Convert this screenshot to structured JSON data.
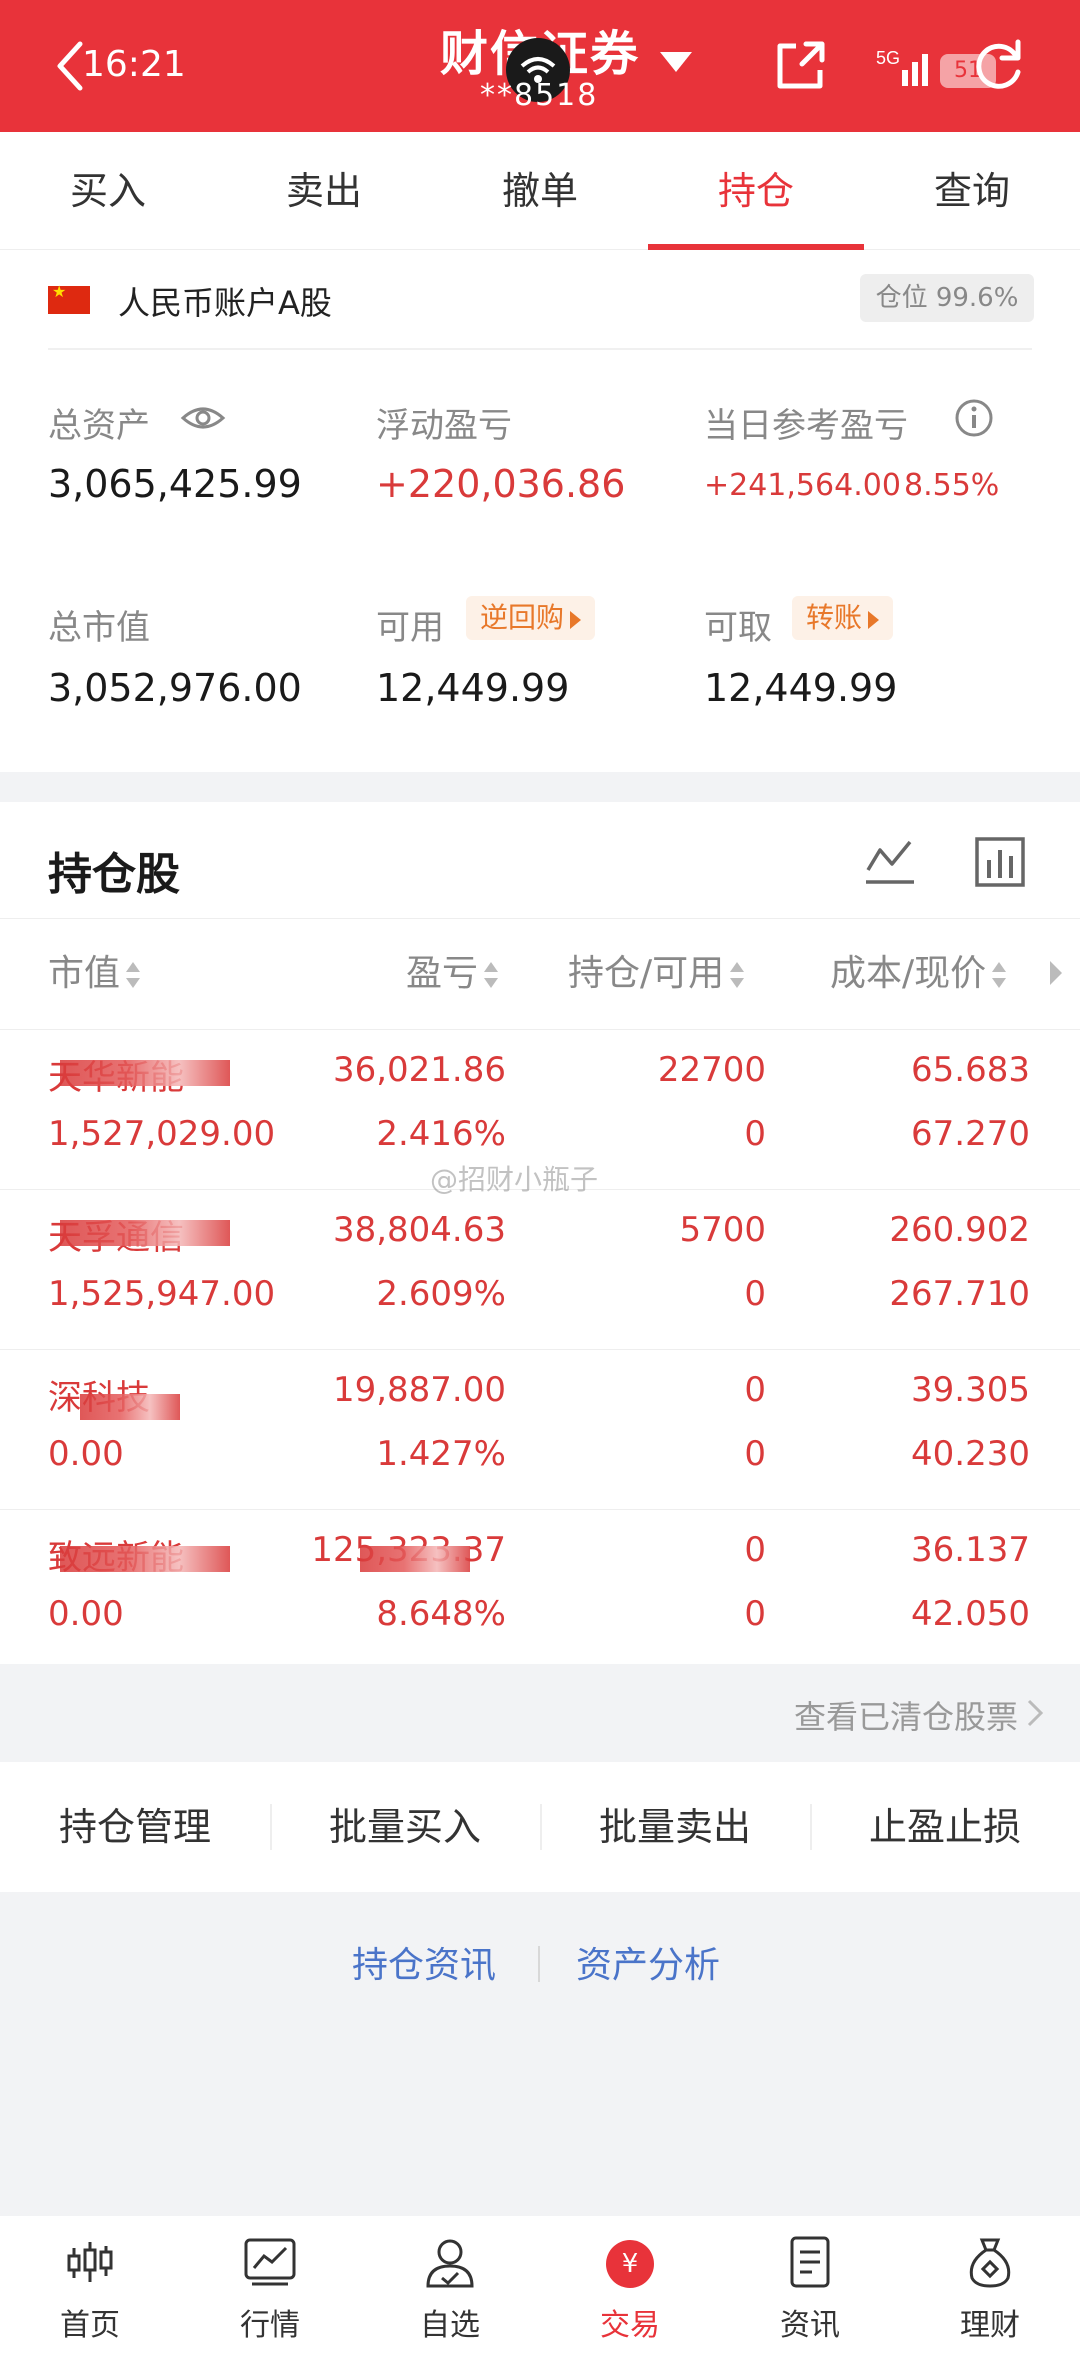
{
  "header": {
    "time": "16:21",
    "title": "财信证券",
    "account_masked": "**8518",
    "battery": "51",
    "network": "5G"
  },
  "tabs": [
    {
      "label": "买入"
    },
    {
      "label": "卖出"
    },
    {
      "label": "撤单"
    },
    {
      "label": "持仓",
      "active": true
    },
    {
      "label": "查询"
    }
  ],
  "account": {
    "name": "人民币账户A股",
    "position_ratio": "仓位 99.6%",
    "total_assets_label": "总资产",
    "total_assets": "3,065,425.99",
    "floating_pl_label": "浮动盈亏",
    "floating_pl": "+220,036.86",
    "daily_pl_label": "当日参考盈亏",
    "daily_pl": "+241,564.00",
    "daily_pl_pct": "8.55%",
    "market_value_label": "总市值",
    "market_value": "3,052,976.00",
    "available_label": "可用",
    "available": "12,449.99",
    "repo_tag": "逆回购",
    "withdrawable_label": "可取",
    "withdrawable": "12,449.99",
    "transfer_tag": "转账"
  },
  "holdings": {
    "title": "持仓股",
    "columns": [
      "市值",
      "盈亏",
      "持仓/可用",
      "成本/现价"
    ],
    "rows": [
      {
        "name": "天华新能",
        "market_value": "1,527,029.00",
        "pl": "36,021.86",
        "pl_pct": "2.416%",
        "position": "22700",
        "available": "0",
        "cost": "65.683",
        "price": "67.270"
      },
      {
        "name": "天孚通信",
        "market_value": "1,525,947.00",
        "pl": "38,804.63",
        "pl_pct": "2.609%",
        "position": "5700",
        "available": "0",
        "cost": "260.902",
        "price": "267.710"
      },
      {
        "name": "深科技",
        "market_value": "0.00",
        "pl": "19,887.00",
        "pl_pct": "1.427%",
        "position": "0",
        "available": "0",
        "cost": "39.305",
        "price": "40.230"
      },
      {
        "name": "致远新能",
        "market_value": "0.00",
        "pl": "125,323.37",
        "pl_pct": "8.648%",
        "position": "0",
        "available": "0",
        "cost": "36.137",
        "price": "42.050"
      }
    ],
    "cleared_link": "查看已清仓股票"
  },
  "watermark": "@招财小瓶子",
  "actions": [
    "持仓管理",
    "批量买入",
    "批量卖出",
    "止盈止损"
  ],
  "links": [
    "持仓资讯",
    "资产分析"
  ],
  "bottom_nav": [
    {
      "label": "首页",
      "icon": "candlestick-icon"
    },
    {
      "label": "行情",
      "icon": "trend-chart-icon"
    },
    {
      "label": "自选",
      "icon": "person-check-icon"
    },
    {
      "label": "交易",
      "icon": "yuan-icon",
      "active": true
    },
    {
      "label": "资讯",
      "icon": "document-icon"
    },
    {
      "label": "理财",
      "icon": "money-bag-icon"
    }
  ],
  "colors": {
    "brand_red": "#e8333a",
    "gain_red": "#d93a3a",
    "link_blue": "#4a74c9",
    "tag_orange": "#e8782a"
  }
}
